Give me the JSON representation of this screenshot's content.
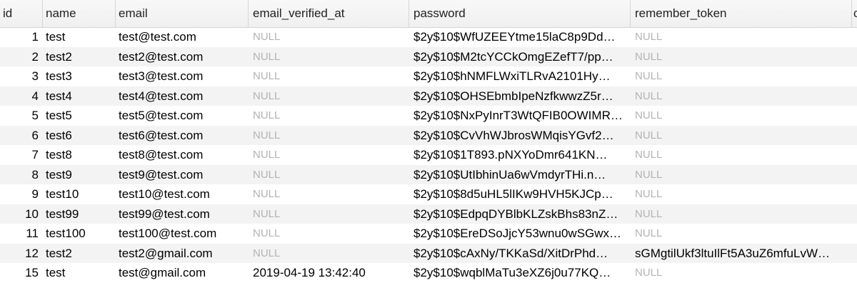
{
  "columns": [
    "id",
    "name",
    "email",
    "email_verified_at",
    "password",
    "remember_token",
    "c"
  ],
  "rows": [
    {
      "id": "1",
      "name": "test",
      "email": "test@test.com",
      "email_verified_at": "NULL",
      "password": "$2y$10$WfUZEEYtme15laC8p9Dd…",
      "remember_token": "NULL"
    },
    {
      "id": "2",
      "name": "test2",
      "email": "test2@test.com",
      "email_verified_at": "NULL",
      "password": "$2y$10$M2tcYCCkOmgEZefT7/pp…",
      "remember_token": "NULL"
    },
    {
      "id": "3",
      "name": "test3",
      "email": "test3@test.com",
      "email_verified_at": "NULL",
      "password": "$2y$10$hNMFLWxiTLRvA2101Hy…",
      "remember_token": "NULL"
    },
    {
      "id": "4",
      "name": "test4",
      "email": "test4@test.com",
      "email_verified_at": "NULL",
      "password": "$2y$10$OHSEbmbIpeNzfkwwzZ5r…",
      "remember_token": "NULL"
    },
    {
      "id": "5",
      "name": "test5",
      "email": "test5@test.com",
      "email_verified_at": "NULL",
      "password": "$2y$10$NxPyInrT3WtQFIB0OWIMR…",
      "remember_token": "NULL"
    },
    {
      "id": "6",
      "name": "test6",
      "email": "test6@test.com",
      "email_verified_at": "NULL",
      "password": "$2y$10$CvVhWJbrosWMqisYGvf2…",
      "remember_token": "NULL"
    },
    {
      "id": "7",
      "name": "test8",
      "email": "test8@test.com",
      "email_verified_at": "NULL",
      "password": "$2y$10$1T893.pNXYoDmr641KN…",
      "remember_token": "NULL"
    },
    {
      "id": "8",
      "name": "test9",
      "email": "test9@test.com",
      "email_verified_at": "NULL",
      "password": "$2y$10$UtIbhinUa6wVmdyrTHi.n…",
      "remember_token": "NULL"
    },
    {
      "id": "9",
      "name": "test10",
      "email": "test10@test.com",
      "email_verified_at": "NULL",
      "password": "$2y$10$8d5uHL5lIKw9HVH5KJCp…",
      "remember_token": "NULL"
    },
    {
      "id": "10",
      "name": "test99",
      "email": "test99@test.com",
      "email_verified_at": "NULL",
      "password": "$2y$10$EdpqDYBlbKLZskBhs83nZ…",
      "remember_token": "NULL"
    },
    {
      "id": "11",
      "name": "test100",
      "email": "test100@test.com",
      "email_verified_at": "NULL",
      "password": "$2y$10$EreDSoJjcY53wnu0wSGwx…",
      "remember_token": "NULL"
    },
    {
      "id": "12",
      "name": "test2",
      "email": "test2@gmail.com",
      "email_verified_at": "NULL",
      "password": "$2y$10$cAxNy/TKKaSd/XitDrPhd…",
      "remember_token": "sGMgtilUkf3ltuIlFt5A3uZ6mfuLvW…"
    },
    {
      "id": "15",
      "name": "test",
      "email": "test@gmail.com",
      "email_verified_at": "2019-04-19 13:42:40",
      "password": "$2y$10$wqblMaTu3eXZ6j0u77KQ…",
      "remember_token": "NULL"
    }
  ],
  "colors": {
    "null_text": "#b3b3b3",
    "row_alt": "#f3f3f3",
    "header_bg": "#f0f0f0"
  }
}
